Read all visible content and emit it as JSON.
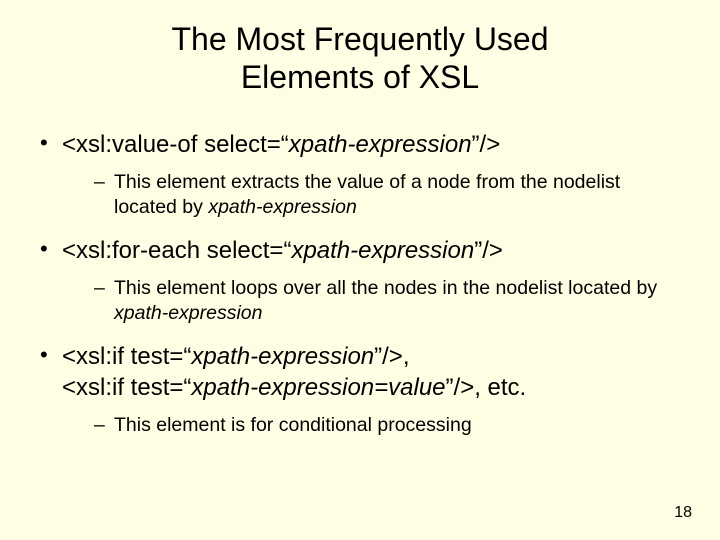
{
  "title_line1": "The Most Frequently Used",
  "title_line2": "Elements of XSL",
  "bullets": [
    {
      "main_pre": "<xsl:value-of select=“",
      "main_em": "xpath-expression",
      "main_post": "”/>",
      "sub_pre": "This element extracts the value of a node from the nodelist located by ",
      "sub_em": "xpath-expression",
      "sub_post": ""
    },
    {
      "main_pre": "<xsl:for-each select=“",
      "main_em": "xpath-expression",
      "main_post": "”/>",
      "sub_pre": "This element loops over all the nodes in the nodelist located by ",
      "sub_em": "xpath-expression",
      "sub_post": ""
    },
    {
      "main_pre": "<xsl:if test=“",
      "main_em": "xpath-expression",
      "main_mid": "”/>,",
      "main_pre2": "<xsl:if test=“",
      "main_em2": "xpath-expression=value",
      "main_post": "”/>, etc.",
      "sub_pre": "This element is for conditional processing",
      "sub_em": "",
      "sub_post": ""
    }
  ],
  "page_number": "18"
}
